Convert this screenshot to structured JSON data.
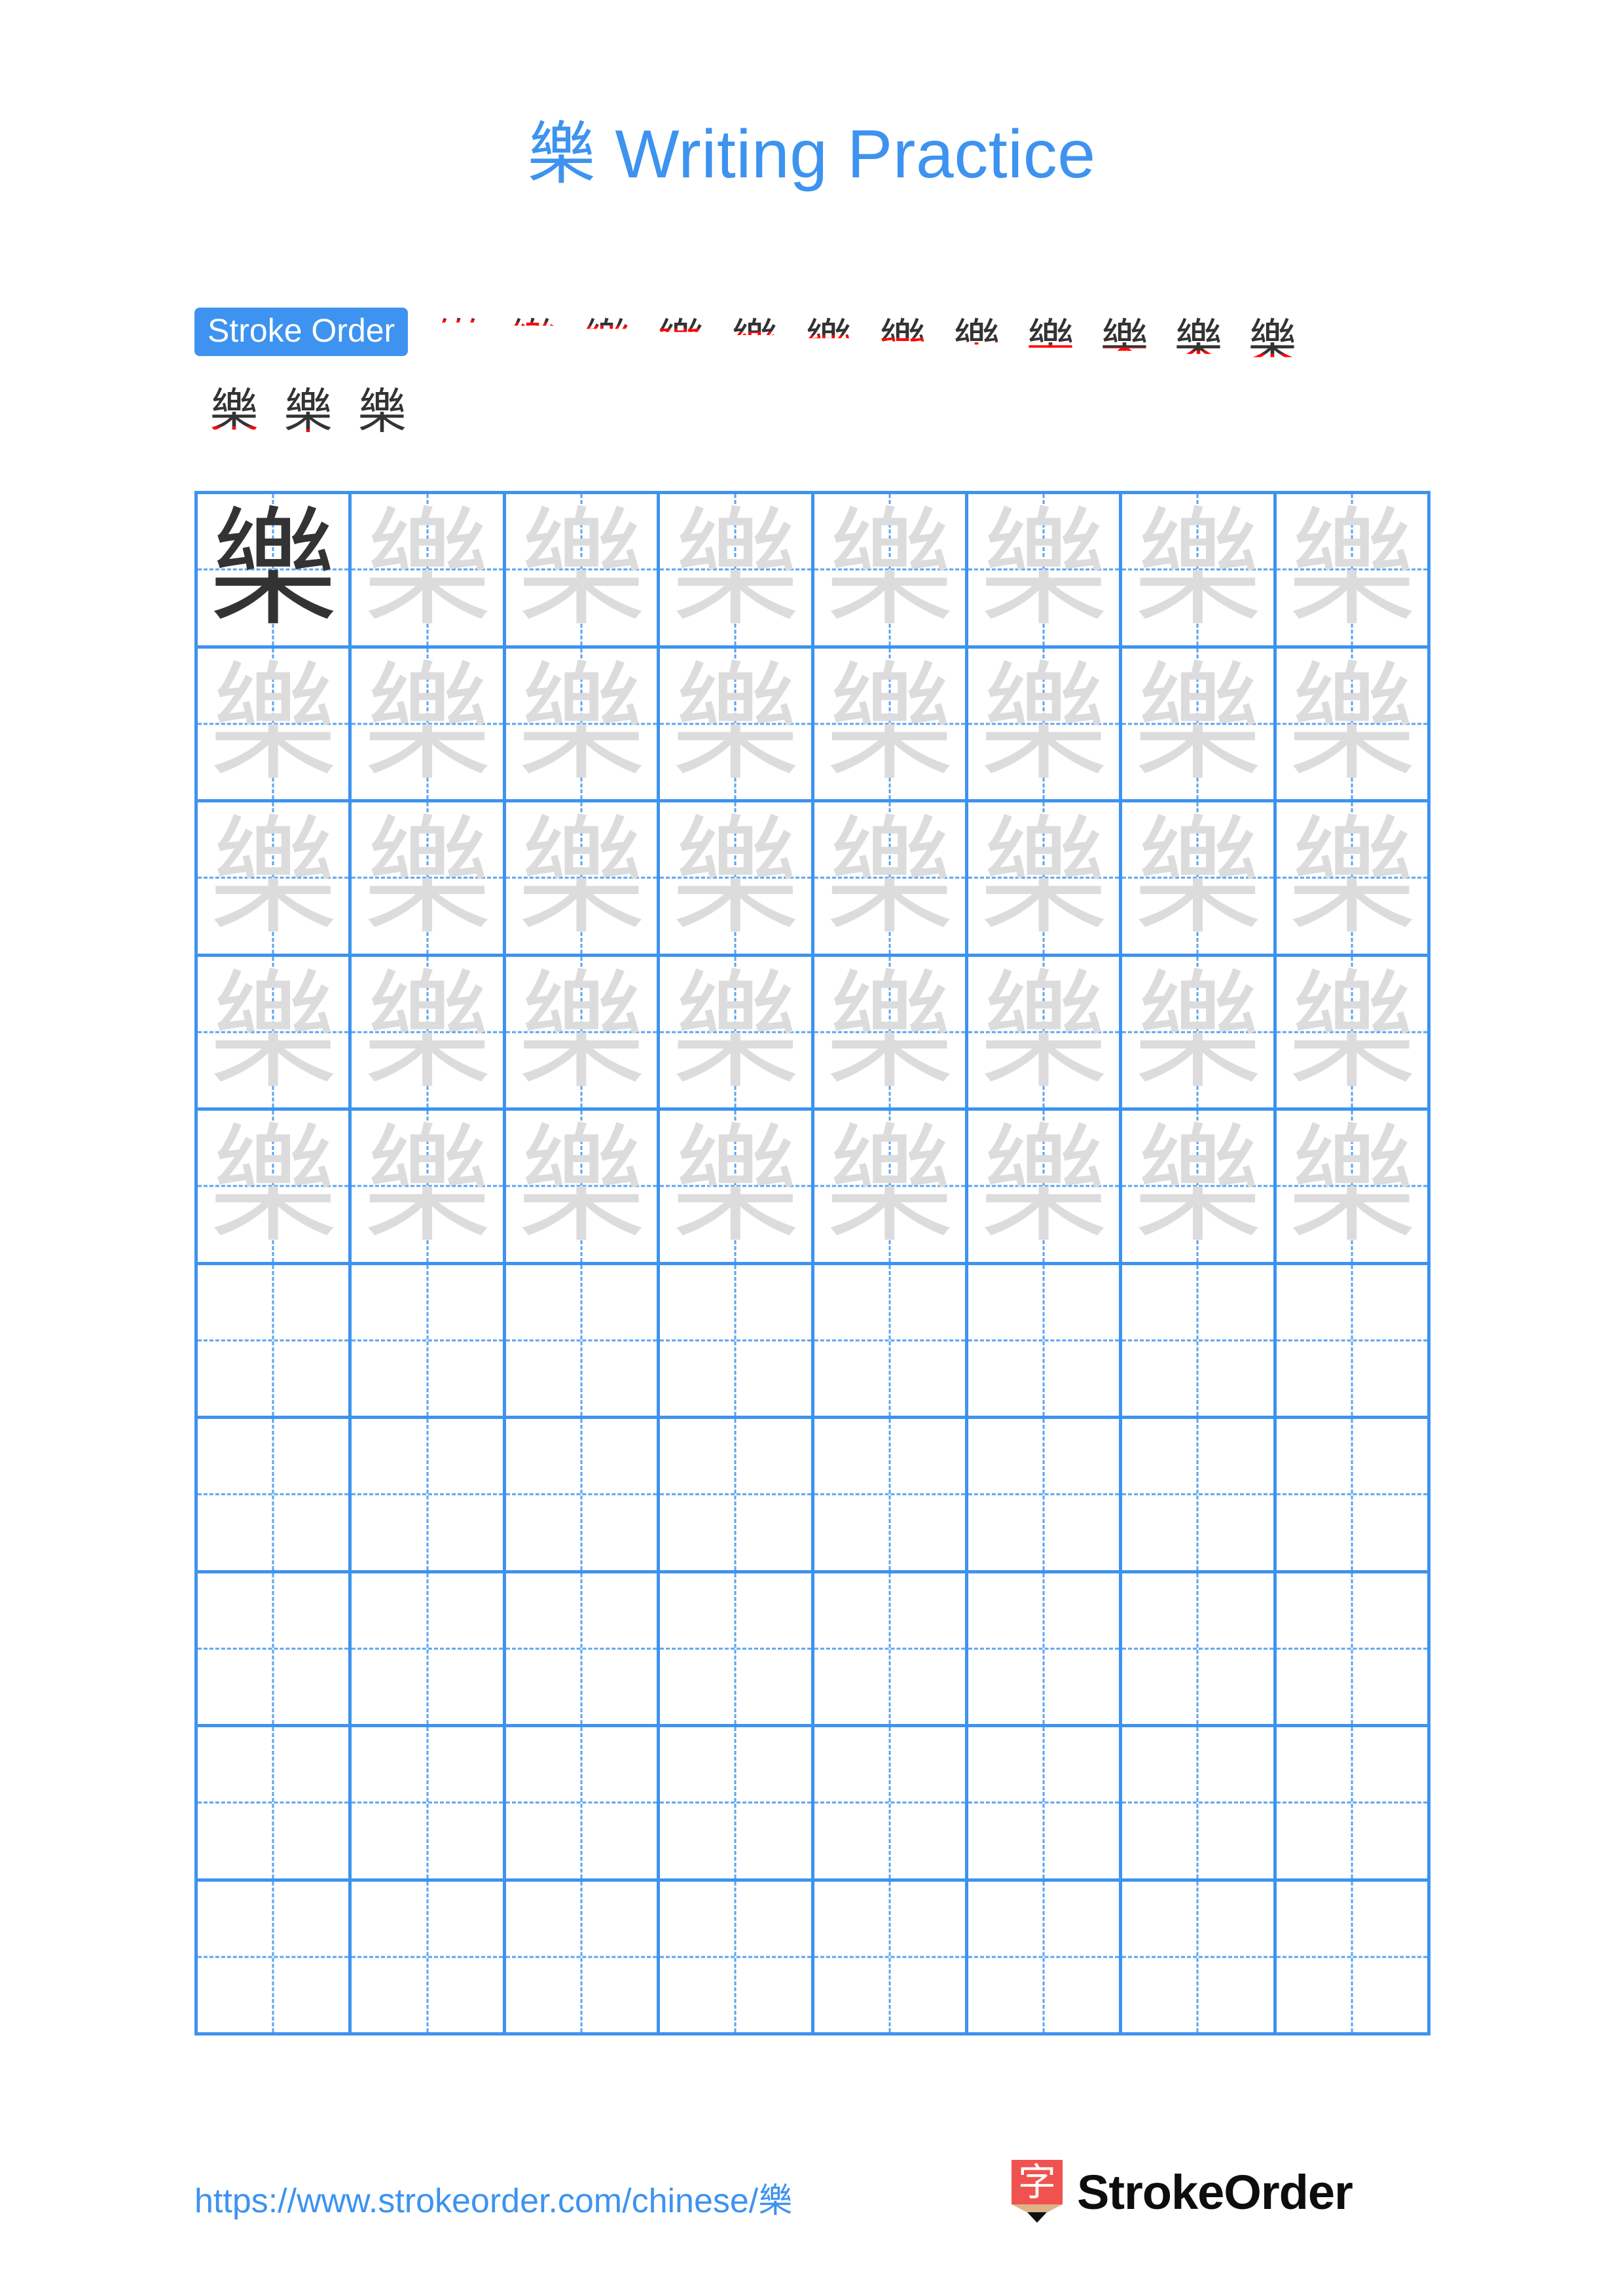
{
  "page": {
    "character": "樂",
    "background_color": "#ffffff",
    "accent_color": "#3d93ef",
    "stroke_done_color": "#333333",
    "stroke_new_color": "#ff0000",
    "trace_color": "#dcdcdc"
  },
  "header": {
    "title_character": "樂",
    "title_text": "Writing Practice"
  },
  "stroke_order": {
    "badge_label": "Stroke Order",
    "total_strokes": 15,
    "row1_steps": [
      {
        "step": 1,
        "glyph": "丿"
      },
      {
        "step": 2,
        "glyph": "亻"
      },
      {
        "step": 3,
        "glyph": "冇"
      },
      {
        "step": 4,
        "glyph": "白"
      },
      {
        "step": 5,
        "glyph": "白"
      },
      {
        "step": 6,
        "glyph": "乊白"
      },
      {
        "step": 7,
        "glyph": "幺白"
      },
      {
        "step": 8,
        "glyph": "纥"
      },
      {
        "step": 9,
        "glyph": "幽"
      },
      {
        "step": 10,
        "glyph": "丝幺"
      },
      {
        "step": 11,
        "glyph": "丝丝"
      },
      {
        "step": 12,
        "glyph": "絲"
      }
    ],
    "row2_steps": [
      {
        "step": 13,
        "glyph": "樂"
      },
      {
        "step": 14,
        "glyph": "樂"
      },
      {
        "step": 15,
        "glyph": "樂"
      }
    ]
  },
  "practice_grid": {
    "columns": 8,
    "rows": 10,
    "grid_line_color": "#3d93ef",
    "guide_line_color": "#5ba4f0",
    "cells": [
      [
        {
          "char": "樂",
          "tone": "dark"
        },
        {
          "char": "樂",
          "tone": "light"
        },
        {
          "char": "樂",
          "tone": "light"
        },
        {
          "char": "樂",
          "tone": "light"
        },
        {
          "char": "樂",
          "tone": "light"
        },
        {
          "char": "樂",
          "tone": "light"
        },
        {
          "char": "樂",
          "tone": "light"
        },
        {
          "char": "樂",
          "tone": "light"
        }
      ],
      [
        {
          "char": "樂",
          "tone": "light"
        },
        {
          "char": "樂",
          "tone": "light"
        },
        {
          "char": "樂",
          "tone": "light"
        },
        {
          "char": "樂",
          "tone": "light"
        },
        {
          "char": "樂",
          "tone": "light"
        },
        {
          "char": "樂",
          "tone": "light"
        },
        {
          "char": "樂",
          "tone": "light"
        },
        {
          "char": "樂",
          "tone": "light"
        }
      ],
      [
        {
          "char": "樂",
          "tone": "light"
        },
        {
          "char": "樂",
          "tone": "light"
        },
        {
          "char": "樂",
          "tone": "light"
        },
        {
          "char": "樂",
          "tone": "light"
        },
        {
          "char": "樂",
          "tone": "light"
        },
        {
          "char": "樂",
          "tone": "light"
        },
        {
          "char": "樂",
          "tone": "light"
        },
        {
          "char": "樂",
          "tone": "light"
        }
      ],
      [
        {
          "char": "樂",
          "tone": "light"
        },
        {
          "char": "樂",
          "tone": "light"
        },
        {
          "char": "樂",
          "tone": "light"
        },
        {
          "char": "樂",
          "tone": "light"
        },
        {
          "char": "樂",
          "tone": "light"
        },
        {
          "char": "樂",
          "tone": "light"
        },
        {
          "char": "樂",
          "tone": "light"
        },
        {
          "char": "樂",
          "tone": "light"
        }
      ],
      [
        {
          "char": "樂",
          "tone": "light"
        },
        {
          "char": "樂",
          "tone": "light"
        },
        {
          "char": "樂",
          "tone": "light"
        },
        {
          "char": "樂",
          "tone": "light"
        },
        {
          "char": "樂",
          "tone": "light"
        },
        {
          "char": "樂",
          "tone": "light"
        },
        {
          "char": "樂",
          "tone": "light"
        },
        {
          "char": "樂",
          "tone": "light"
        }
      ],
      [
        {
          "char": "",
          "tone": "empty"
        },
        {
          "char": "",
          "tone": "empty"
        },
        {
          "char": "",
          "tone": "empty"
        },
        {
          "char": "",
          "tone": "empty"
        },
        {
          "char": "",
          "tone": "empty"
        },
        {
          "char": "",
          "tone": "empty"
        },
        {
          "char": "",
          "tone": "empty"
        },
        {
          "char": "",
          "tone": "empty"
        }
      ],
      [
        {
          "char": "",
          "tone": "empty"
        },
        {
          "char": "",
          "tone": "empty"
        },
        {
          "char": "",
          "tone": "empty"
        },
        {
          "char": "",
          "tone": "empty"
        },
        {
          "char": "",
          "tone": "empty"
        },
        {
          "char": "",
          "tone": "empty"
        },
        {
          "char": "",
          "tone": "empty"
        },
        {
          "char": "",
          "tone": "empty"
        }
      ],
      [
        {
          "char": "",
          "tone": "empty"
        },
        {
          "char": "",
          "tone": "empty"
        },
        {
          "char": "",
          "tone": "empty"
        },
        {
          "char": "",
          "tone": "empty"
        },
        {
          "char": "",
          "tone": "empty"
        },
        {
          "char": "",
          "tone": "empty"
        },
        {
          "char": "",
          "tone": "empty"
        },
        {
          "char": "",
          "tone": "empty"
        }
      ],
      [
        {
          "char": "",
          "tone": "empty"
        },
        {
          "char": "",
          "tone": "empty"
        },
        {
          "char": "",
          "tone": "empty"
        },
        {
          "char": "",
          "tone": "empty"
        },
        {
          "char": "",
          "tone": "empty"
        },
        {
          "char": "",
          "tone": "empty"
        },
        {
          "char": "",
          "tone": "empty"
        },
        {
          "char": "",
          "tone": "empty"
        }
      ],
      [
        {
          "char": "",
          "tone": "empty"
        },
        {
          "char": "",
          "tone": "empty"
        },
        {
          "char": "",
          "tone": "empty"
        },
        {
          "char": "",
          "tone": "empty"
        },
        {
          "char": "",
          "tone": "empty"
        },
        {
          "char": "",
          "tone": "empty"
        },
        {
          "char": "",
          "tone": "empty"
        },
        {
          "char": "",
          "tone": "empty"
        }
      ]
    ]
  },
  "footer": {
    "url": "https://www.strokeorder.com/chinese/樂",
    "brand_name": "StrokeOrder",
    "brand_logo_char": "字"
  }
}
